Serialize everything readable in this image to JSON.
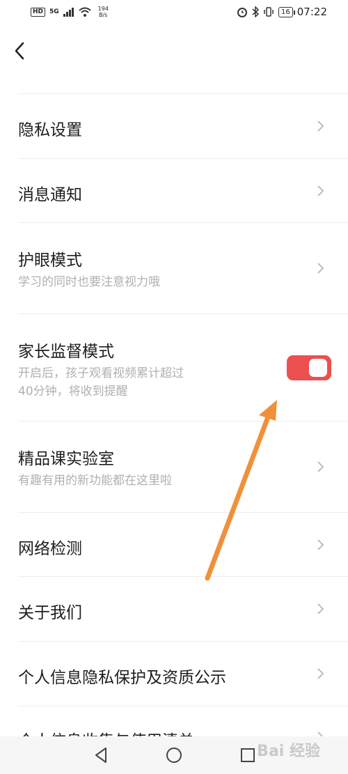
{
  "status_bar": {
    "hd": "HD",
    "signal": "5G",
    "speed_value": "194",
    "speed_unit": "B/s",
    "battery": "16",
    "time": "07:22"
  },
  "settings": [
    {
      "title": "隐私设置",
      "control": "chevron"
    },
    {
      "title": "消息通知",
      "control": "chevron"
    },
    {
      "title": "护眼模式",
      "subtitle": "学习的同时也要注意视力哦",
      "control": "chevron"
    },
    {
      "title": "家长监督模式",
      "subtitle_line1": "开启后，孩子观看视频累计超过",
      "subtitle_line2": "40分钟，将收到提醒",
      "control": "toggle",
      "enabled": true
    },
    {
      "title": "精品课实验室",
      "subtitle": "有趣有用的新功能都在这里啦",
      "control": "chevron"
    },
    {
      "title": "网络检测",
      "control": "chevron"
    },
    {
      "title": "关于我们",
      "control": "chevron"
    },
    {
      "title": "个人信息隐私保护及资质公示",
      "control": "chevron"
    },
    {
      "title": "个人信息收集与使用清单",
      "control": "chevron"
    }
  ],
  "watermark": "Bai 经验",
  "colors": {
    "toggle_on": "#ec4f4f",
    "annotation_arrow": "#f0903a"
  }
}
